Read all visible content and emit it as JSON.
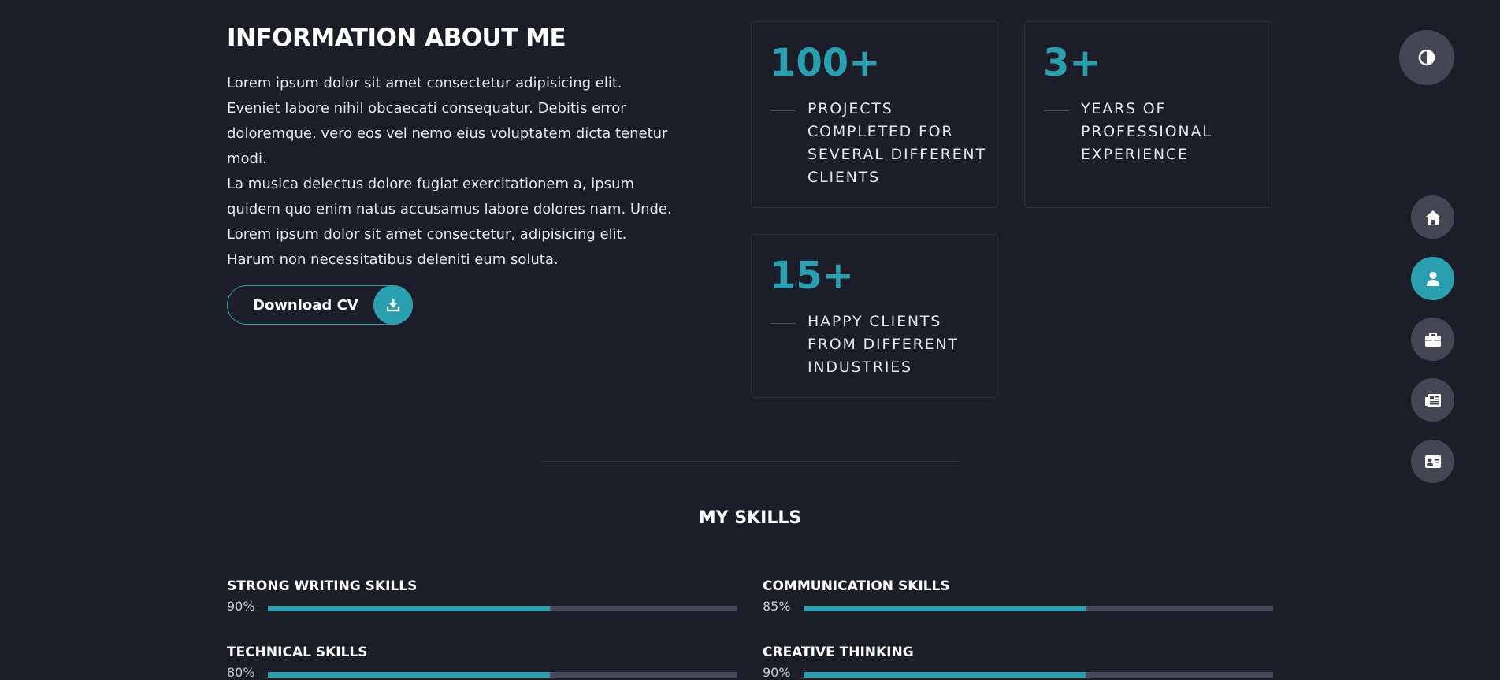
{
  "about": {
    "title": "INFORMATION ABOUT ME",
    "paragraph_1": "Lorem ipsum dolor sit amet consectetur adipisicing elit. Eveniet labore nihil obcaecati consequatur. Debitis error doloremque, vero eos vel nemo eius voluptatem dicta tenetur modi.",
    "paragraph_2": "La musica delectus dolore fugiat exercitationem a, ipsum quidem quo enim natus accusamus labore dolores nam. Unde. Lorem ipsum dolor sit amet consectetur, adipisicing elit. Harum non necessitatibus deleniti eum soluta.",
    "cv_button": {
      "label": "Download CV",
      "icon": "download-icon"
    }
  },
  "stats": [
    {
      "number": "100+",
      "label": "PROJECTS COMPLETED FOR SEVERAL DIFFERENT CLIENTS"
    },
    {
      "number": "3+",
      "label": "YEARS OF PROFESSIONAL EXPERIENCE"
    },
    {
      "number": "15+",
      "label": "HAPPY CLIENTS FROM DIFFERENT INDUSTRIES"
    }
  ],
  "skills": {
    "title": "MY SKILLS",
    "items": [
      {
        "name": "STRONG WRITING SKILLS",
        "percent": "90%",
        "bar_fill": 0.6
      },
      {
        "name": "COMMUNICATION SKILLS",
        "percent": "85%",
        "bar_fill": 0.6
      },
      {
        "name": "TECHNICAL SKILLS",
        "percent": "80%",
        "bar_fill": 0.6
      },
      {
        "name": "CREATIVE THINKING",
        "percent": "90%",
        "bar_fill": 0.6
      }
    ]
  },
  "nav": {
    "theme_toggle_icon": "contrast-icon",
    "items": [
      {
        "icon": "home-icon",
        "active": false
      },
      {
        "icon": "user-icon",
        "active": true
      },
      {
        "icon": "briefcase-icon",
        "active": false
      },
      {
        "icon": "newspaper-icon",
        "active": false
      },
      {
        "icon": "contact-card-icon",
        "active": false
      }
    ]
  },
  "colors": {
    "background": "#1b1d29",
    "accent": "#2a9fb0",
    "muted_button": "#444753",
    "track": "#464a58",
    "text": "#ffffff"
  }
}
